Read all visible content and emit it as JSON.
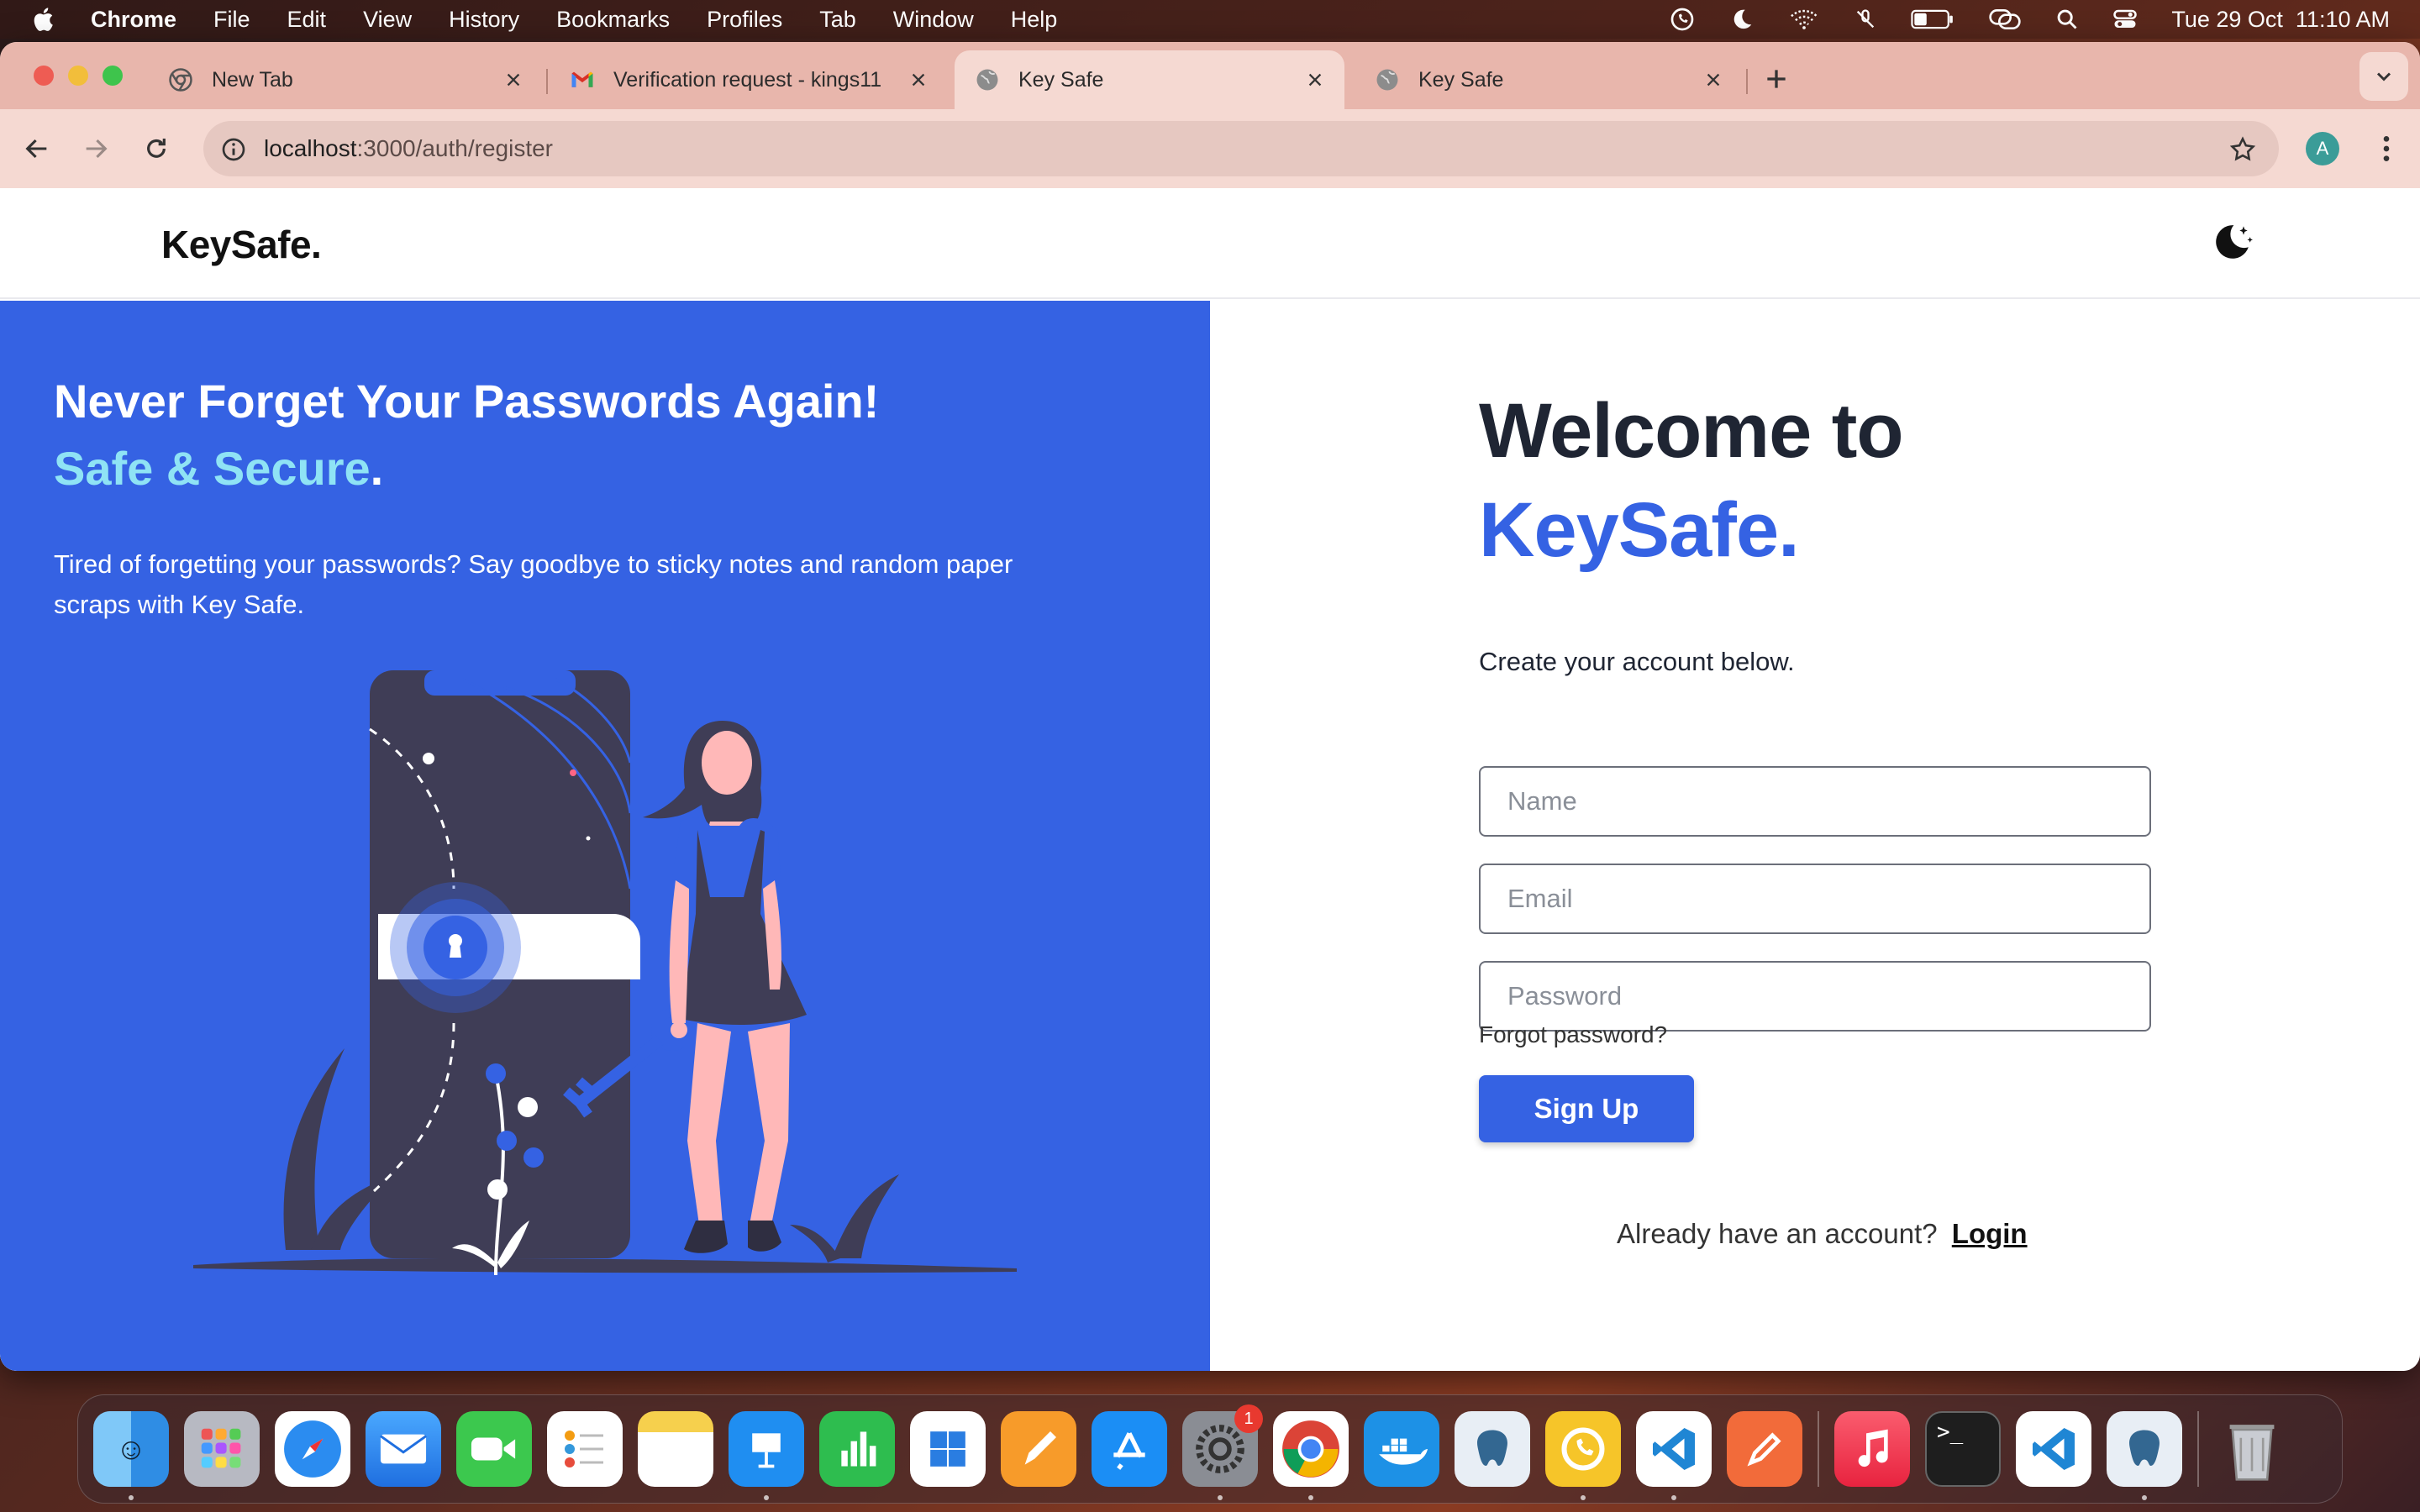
{
  "menubar": {
    "app_name": "Chrome",
    "items": [
      "File",
      "Edit",
      "View",
      "History",
      "Bookmarks",
      "Profiles",
      "Tab",
      "Window",
      "Help"
    ],
    "clock": "Tue 29 Oct  11:10 AM",
    "status_icons": [
      "whatsapp-icon",
      "moon-icon",
      "wifi-icon",
      "mic-off-icon",
      "battery-icon",
      "screen-mirroring-icon",
      "search-icon",
      "control-center-icon"
    ]
  },
  "browser": {
    "tabs": [
      {
        "label": "New Tab",
        "icon": "chrome-icon"
      },
      {
        "label": "Verification request - kings11",
        "icon": "gmail-icon"
      },
      {
        "label": "Key Safe",
        "icon": "globe-icon",
        "active": true
      },
      {
        "label": "Key Safe",
        "icon": "globe-icon"
      }
    ],
    "address": {
      "host": "localhost",
      "path": ":3000/auth/register"
    },
    "profile_initial": "A"
  },
  "site": {
    "logo": "KeySafe.",
    "hero": {
      "title_part1": "Never Forget Your Passwords Again! ",
      "title_accent": "Safe & Secure",
      "title_end": ".",
      "description": "Tired of forgetting your passwords? Say goodbye to sticky notes and random paper scraps with Key Safe."
    },
    "form": {
      "welcome_line1": "Welcome to",
      "welcome_brand": "KeySafe.",
      "subtitle": "Create your account below.",
      "name_placeholder": "Name",
      "email_placeholder": "Email",
      "password_placeholder": "Password",
      "forgot_label": "Forgot password?",
      "signup_label": "Sign Up",
      "already_text": "Already have an account?",
      "login_label": "Login"
    }
  },
  "dock": {
    "apps": [
      "Finder",
      "Launchpad",
      "Safari",
      "Mail",
      "FaceTime",
      "Reminders",
      "Notes",
      "Keynote",
      "Numbers",
      "Windows App",
      "Pages",
      "App Store",
      "System Settings",
      "Google Chrome",
      "Docker",
      "pgAdmin",
      "WhatsApp",
      "Visual Studio Code",
      "Postman",
      "Music",
      "Terminal",
      "Visual Studio Code",
      "pgAdmin",
      "Trash"
    ],
    "settings_badge": "1"
  },
  "colors": {
    "brand_blue": "#3562e3",
    "accent_cyan": "#8fe3f5",
    "heading_dark": "#1f2533"
  }
}
